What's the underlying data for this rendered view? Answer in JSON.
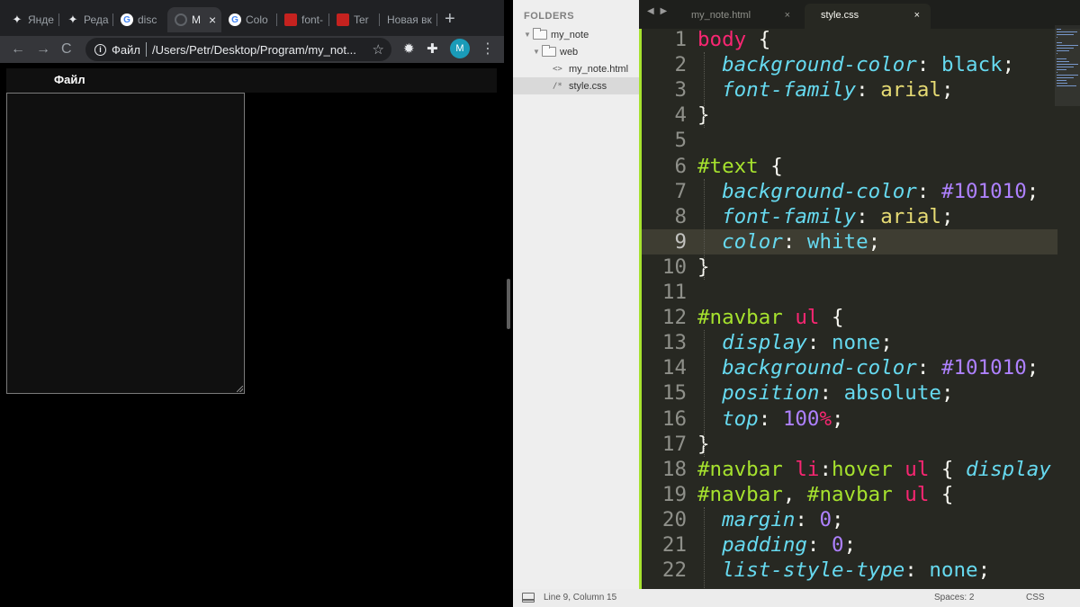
{
  "browser": {
    "tabs": [
      {
        "label": "Янде",
        "icon": "sparkle-icon",
        "active": false
      },
      {
        "label": "Реда",
        "icon": "sparkle-icon",
        "active": false
      },
      {
        "label": "disc",
        "icon": "google-icon",
        "active": false
      },
      {
        "label": "M",
        "icon": "globe-icon",
        "active": true,
        "close": "×"
      },
      {
        "label": "Colo",
        "icon": "google-icon",
        "active": false
      },
      {
        "label": "font-",
        "icon": "red-page-icon",
        "active": false
      },
      {
        "label": "Ter",
        "icon": "red-page-icon",
        "active": false
      },
      {
        "label": "Новая вк",
        "icon": "",
        "active": false
      }
    ],
    "new_tab": "+",
    "nav": {
      "back": "←",
      "forward": "→",
      "reload": "C"
    },
    "omnibox": {
      "info_glyph": "i",
      "scheme_label": "Файл",
      "url": "/Users/Petr/Desktop/Program/my_not...",
      "bookmark_glyph": "☆"
    },
    "extensions": {
      "gear": "✹",
      "puzzle": "✚"
    },
    "profile_initial": "M",
    "menu_glyph": "⋮",
    "page": {
      "navbar_text": "Файл"
    }
  },
  "sidebar": {
    "title": "FOLDERS",
    "items": [
      {
        "label": "my_note",
        "type": "folder",
        "expanded": true
      },
      {
        "label": "web",
        "type": "folder",
        "expanded": true
      },
      {
        "label": "my_note.html",
        "type": "file",
        "icon": "<>"
      },
      {
        "label": "style.css",
        "type": "file",
        "icon": "/*",
        "selected": true
      }
    ]
  },
  "editor": {
    "tab_nav": "◀ ▶",
    "tabs": [
      {
        "label": "my_note.html",
        "active": false,
        "close": "×"
      },
      {
        "label": "style.css",
        "active": true,
        "close": "×"
      }
    ],
    "current_line": 9,
    "code_lines": [
      {
        "n": "1",
        "tokens": [
          [
            "t-tag",
            "body"
          ],
          [
            "t-punct",
            " {"
          ]
        ]
      },
      {
        "n": "2",
        "tokens": [
          [
            "t-punct",
            "  "
          ],
          [
            "t-prop",
            "background-color"
          ],
          [
            "t-punct",
            ": "
          ],
          [
            "t-val",
            "black"
          ],
          [
            "t-punct",
            ";"
          ]
        ]
      },
      {
        "n": "3",
        "tokens": [
          [
            "t-punct",
            "  "
          ],
          [
            "t-prop",
            "font-family"
          ],
          [
            "t-punct",
            ": "
          ],
          [
            "t-str",
            "arial"
          ],
          [
            "t-punct",
            ";"
          ]
        ]
      },
      {
        "n": "4",
        "tokens": [
          [
            "t-punct",
            "}"
          ]
        ]
      },
      {
        "n": "5",
        "tokens": []
      },
      {
        "n": "6",
        "tokens": [
          [
            "t-sel",
            "#text"
          ],
          [
            "t-punct",
            " {"
          ]
        ]
      },
      {
        "n": "7",
        "tokens": [
          [
            "t-punct",
            "  "
          ],
          [
            "t-prop",
            "background-color"
          ],
          [
            "t-punct",
            ": "
          ],
          [
            "t-num",
            "#101010"
          ],
          [
            "t-punct",
            ";"
          ]
        ]
      },
      {
        "n": "8",
        "tokens": [
          [
            "t-punct",
            "  "
          ],
          [
            "t-prop",
            "font-family"
          ],
          [
            "t-punct",
            ": "
          ],
          [
            "t-str",
            "arial"
          ],
          [
            "t-punct",
            ";"
          ]
        ]
      },
      {
        "n": "9",
        "tokens": [
          [
            "t-punct",
            "  "
          ],
          [
            "t-prop",
            "color"
          ],
          [
            "t-punct",
            ": "
          ],
          [
            "t-val",
            "white"
          ],
          [
            "t-punct",
            ";"
          ]
        ]
      },
      {
        "n": "10",
        "tokens": [
          [
            "t-punct",
            "}"
          ]
        ]
      },
      {
        "n": "11",
        "tokens": []
      },
      {
        "n": "12",
        "tokens": [
          [
            "t-sel",
            "#navbar"
          ],
          [
            "t-punct",
            " "
          ],
          [
            "t-tag",
            "ul"
          ],
          [
            "t-punct",
            " {"
          ]
        ]
      },
      {
        "n": "13",
        "tokens": [
          [
            "t-punct",
            "  "
          ],
          [
            "t-prop",
            "display"
          ],
          [
            "t-punct",
            ": "
          ],
          [
            "t-val",
            "none"
          ],
          [
            "t-punct",
            ";"
          ]
        ]
      },
      {
        "n": "14",
        "tokens": [
          [
            "t-punct",
            "  "
          ],
          [
            "t-prop",
            "background-color"
          ],
          [
            "t-punct",
            ": "
          ],
          [
            "t-num",
            "#101010"
          ],
          [
            "t-punct",
            ";"
          ]
        ]
      },
      {
        "n": "15",
        "tokens": [
          [
            "t-punct",
            "  "
          ],
          [
            "t-prop",
            "position"
          ],
          [
            "t-punct",
            ": "
          ],
          [
            "t-val",
            "absolute"
          ],
          [
            "t-punct",
            ";"
          ]
        ]
      },
      {
        "n": "16",
        "tokens": [
          [
            "t-punct",
            "  "
          ],
          [
            "t-prop",
            "top"
          ],
          [
            "t-punct",
            ": "
          ],
          [
            "t-num",
            "100"
          ],
          [
            "t-unit",
            "%"
          ],
          [
            "t-punct",
            ";"
          ]
        ]
      },
      {
        "n": "17",
        "tokens": [
          [
            "t-punct",
            "}"
          ]
        ]
      },
      {
        "n": "18",
        "tokens": [
          [
            "t-sel",
            "#navbar"
          ],
          [
            "t-punct",
            " "
          ],
          [
            "t-tag",
            "li"
          ],
          [
            "t-punct",
            ":"
          ],
          [
            "t-sel",
            "hover"
          ],
          [
            "t-punct",
            " "
          ],
          [
            "t-tag",
            "ul"
          ],
          [
            "t-punct",
            " { "
          ],
          [
            "t-prop",
            "display"
          ]
        ]
      },
      {
        "n": "19",
        "tokens": [
          [
            "t-sel",
            "#navbar"
          ],
          [
            "t-punct",
            ", "
          ],
          [
            "t-sel",
            "#navbar"
          ],
          [
            "t-punct",
            " "
          ],
          [
            "t-tag",
            "ul"
          ],
          [
            "t-punct",
            " {"
          ]
        ]
      },
      {
        "n": "20",
        "tokens": [
          [
            "t-punct",
            "  "
          ],
          [
            "t-prop",
            "margin"
          ],
          [
            "t-punct",
            ": "
          ],
          [
            "t-num",
            "0"
          ],
          [
            "t-punct",
            ";"
          ]
        ]
      },
      {
        "n": "21",
        "tokens": [
          [
            "t-punct",
            "  "
          ],
          [
            "t-prop",
            "padding"
          ],
          [
            "t-punct",
            ": "
          ],
          [
            "t-num",
            "0"
          ],
          [
            "t-punct",
            ";"
          ]
        ]
      },
      {
        "n": "22",
        "tokens": [
          [
            "t-punct",
            "  "
          ],
          [
            "t-prop",
            "list-style-type"
          ],
          [
            "t-punct",
            ": "
          ],
          [
            "t-val",
            "none"
          ],
          [
            "t-punct",
            ";"
          ]
        ]
      }
    ]
  },
  "statusbar": {
    "position": "Line 9, Column 15",
    "indent": "Spaces: 2",
    "syntax": "CSS"
  },
  "colors": {
    "editor_bg": "#272822",
    "keyword_pink": "#f92672",
    "selector_green": "#a6e22e",
    "property_cyan": "#66d9ef",
    "number_purple": "#ae81ff",
    "string_yellow": "#e6db74",
    "avatar_teal": "#1a9bb8"
  }
}
